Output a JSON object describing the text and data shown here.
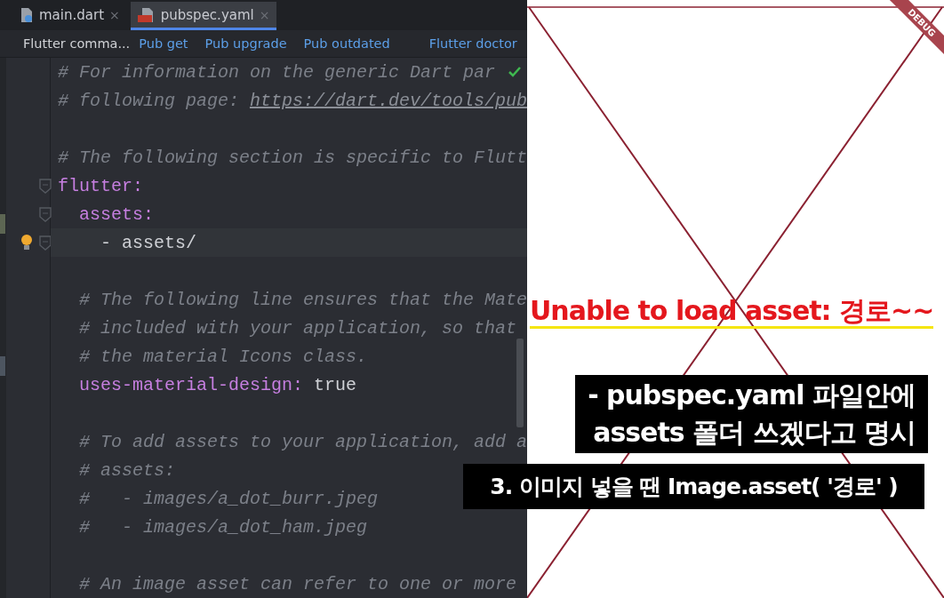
{
  "tabs": [
    {
      "label": "main.dart",
      "kind": "dart",
      "close": "×",
      "selected": false
    },
    {
      "label": "pubspec.yaml",
      "kind": "yaml",
      "close": "×",
      "selected": true
    }
  ],
  "toolbar": {
    "title": "Flutter comma...",
    "actions": [
      "Pub get",
      "Pub upgrade",
      "Pub outdated"
    ],
    "extra_action": "Flutter doctor"
  },
  "code_lines": [
    {
      "kind": "comment",
      "text": "# For information on the generic Dart par",
      "check": true
    },
    {
      "kind": "comment",
      "text": "# following page: ",
      "link": "https://dart.dev/tools/pub"
    },
    {
      "kind": "blank"
    },
    {
      "kind": "comment",
      "text": "# The following section is specific to Flutt"
    },
    {
      "kind": "key",
      "key": "flutter:",
      "fold": true
    },
    {
      "kind": "key",
      "key": "  assets:",
      "fold": true
    },
    {
      "kind": "item",
      "text": "    - assets/",
      "fold": true,
      "bulb": true,
      "current": true
    },
    {
      "kind": "blank"
    },
    {
      "kind": "comment",
      "text": "  # The following line ensures that the Mate"
    },
    {
      "kind": "comment",
      "text": "  # included with your application, so that"
    },
    {
      "kind": "comment",
      "text": "  # the material Icons class."
    },
    {
      "kind": "pair",
      "key": "  uses-material-design:",
      "value": " true"
    },
    {
      "kind": "blank"
    },
    {
      "kind": "comment",
      "text": "  # To add assets to your application, add a"
    },
    {
      "kind": "comment",
      "text": "  # assets:"
    },
    {
      "kind": "comment",
      "text": "  #   - images/a_dot_burr.jpeg"
    },
    {
      "kind": "comment",
      "text": "  #   - images/a_dot_ham.jpeg"
    },
    {
      "kind": "blank"
    },
    {
      "kind": "comment",
      "text": "  # An image asset can refer to one or more"
    }
  ],
  "preview": {
    "banner": "DEBUG"
  },
  "captions": {
    "error": "Unable to load asset: 경로~~",
    "note_lines": [
      "- pubspec.yaml 파일안에",
      "assets 폴더 쓰겠다고 명시"
    ],
    "step": "3. 이미지 넣을 땐 Image.asset( '경로' )"
  }
}
